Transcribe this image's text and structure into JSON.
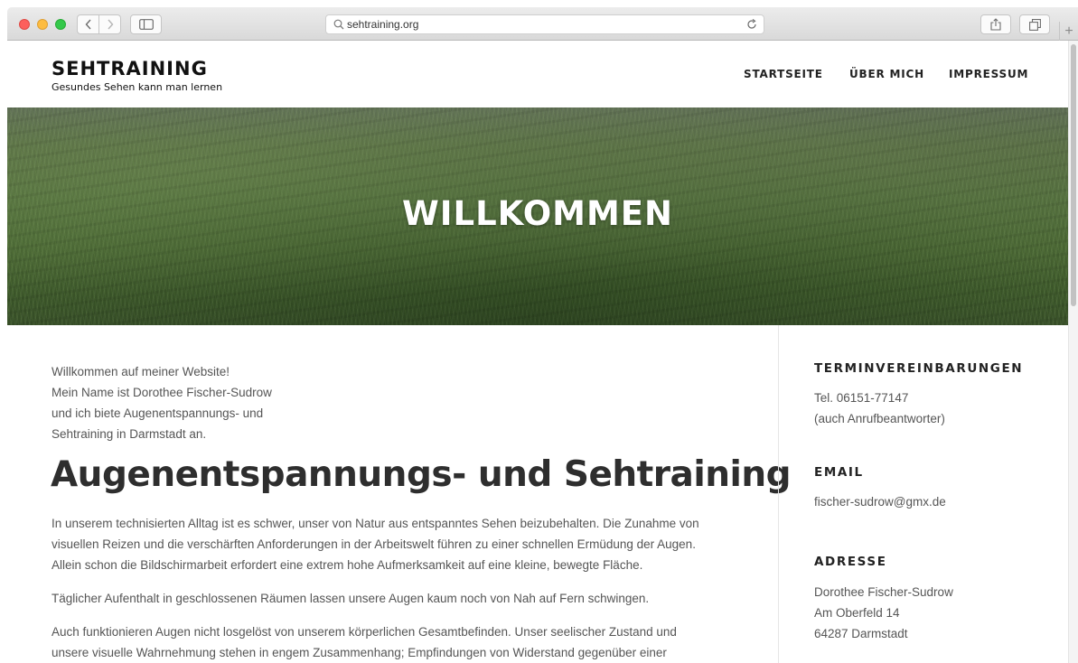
{
  "browser": {
    "url": "sehtraining.org",
    "new_tab_label": "+"
  },
  "site": {
    "title": "SEHTRAINING",
    "tagline": "Gesundes Sehen kann man lernen",
    "nav": [
      "STARTSEITE",
      "ÜBER MICH",
      "IMPRESSUM"
    ]
  },
  "hero": {
    "title": "WILLKOMMEN"
  },
  "intro": {
    "lines": [
      "Willkommen auf meiner Website!",
      "Mein Name ist Dorothee Fischer-Sudrow",
      "und ich biete Augenentspannungs- und",
      "Sehtraining in Darmstadt an."
    ]
  },
  "main": {
    "heading": "Augenentspannungs- und Sehtraining",
    "p1": [
      "In unserem technisierten Alltag ist es schwer, unser von Natur aus entspanntes Sehen beizubehalten. Die Zunahme von",
      "visuellen Reizen und die verschärften Anforderungen in der Arbeitswelt führen zu einer schnellen Ermüdung der Augen.",
      "Allein schon die Bildschirmarbeit erfordert eine extrem hohe Aufmerksamkeit auf eine kleine, bewegte Fläche."
    ],
    "p2": "Täglicher Aufenthalt in geschlossenen Räumen lassen unsere Augen kaum noch von Nah auf Fern schwingen.",
    "p3": [
      "Auch  funktionieren Augen nicht losgelöst von unserem körperlichen Gesamtbefinden. Unser seelischer Zustand und",
      "unsere visuelle Wahrnehmung stehen in engem Zusammenhang; Empfindungen von Widerstand gegenüber einer"
    ]
  },
  "sidebar": {
    "termin": {
      "title": "TERMINVEREINBARUNGEN",
      "lines": [
        "Tel. 06151-77147",
        "(auch Anrufbeantworter)"
      ]
    },
    "email": {
      "title": "EMAIL",
      "value": "fischer-sudrow@gmx.de"
    },
    "adresse": {
      "title": "ADRESSE",
      "lines": [
        "Dorothee Fischer-Sudrow",
        "Am Oberfeld 14",
        "64287 Darmstadt"
      ]
    }
  }
}
